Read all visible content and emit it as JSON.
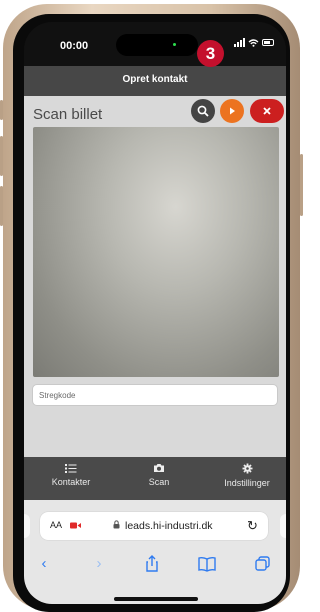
{
  "status_bar": {
    "time": "00:00"
  },
  "header": {
    "title": "Opret kontakt"
  },
  "step_badge": "3",
  "scan_panel": {
    "title": "Scan billet",
    "barcode_placeholder": "Stregkode"
  },
  "tabs": [
    {
      "label": "Kontakter",
      "icon": "list-icon"
    },
    {
      "label": "Scan",
      "icon": "camera-icon"
    },
    {
      "label": "Indstillinger",
      "icon": "gear-icon"
    }
  ],
  "browser": {
    "text_size_label": "AA",
    "url": "leads.hi-industri.dk"
  },
  "colors": {
    "header_bg": "#474747",
    "badge": "#c4102d",
    "play_button": "#ec7320",
    "close_button": "#cc1f1f",
    "safari_accent": "#2f7bf0"
  }
}
